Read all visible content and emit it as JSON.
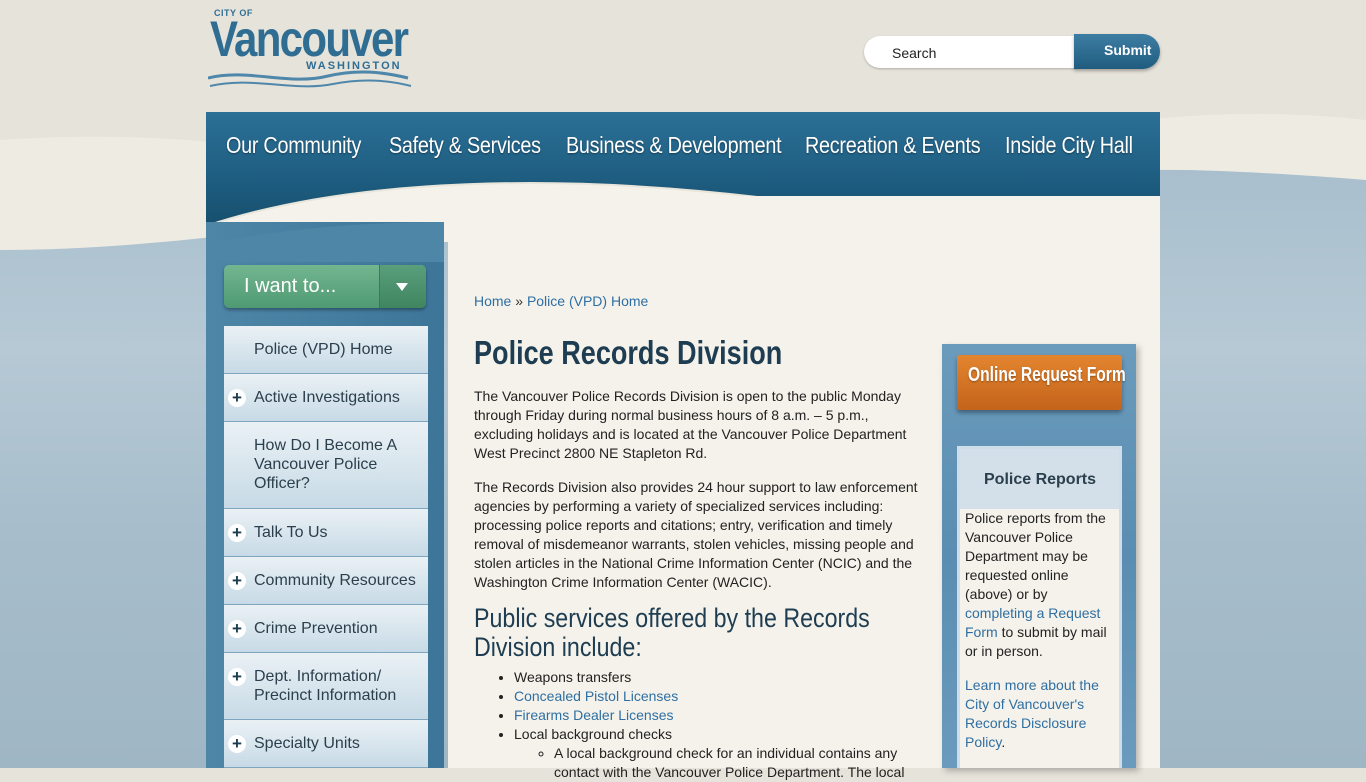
{
  "logo": {
    "city_of": "CITY OF",
    "name": "Vancouver",
    "state": "WASHINGTON"
  },
  "search": {
    "placeholder": "Search",
    "submit_label": "Submit"
  },
  "nav": [
    "Our Community",
    "Safety & Services",
    "Business & Development",
    "Recreation & Events",
    "Inside City Hall"
  ],
  "i_want_to": "I want to...",
  "sidebar": {
    "items": [
      {
        "label": "Police (VPD) Home",
        "expandable": false
      },
      {
        "label": "Active Investigations",
        "expandable": true
      },
      {
        "label": "How Do I Become A Vancouver Police Officer?",
        "expandable": false
      },
      {
        "label": "Talk To Us",
        "expandable": true
      },
      {
        "label": "Community Resources",
        "expandable": true
      },
      {
        "label": "Crime Prevention",
        "expandable": true
      },
      {
        "label": "Dept. Information/ Precinct Information",
        "expandable": true
      },
      {
        "label": "Specialty Units",
        "expandable": true
      }
    ],
    "expand_glyph": "+"
  },
  "breadcrumb": {
    "home": "Home",
    "separator": "»",
    "current": "Police (VPD) Home"
  },
  "main": {
    "title": "Police Records Division",
    "para1": "The Vancouver Police Records Division is open to the public Monday through Friday during normal business hours of 8 a.m. – 5 p.m., excluding holidays and is located at the Vancouver Police Department West Precinct 2800 NE Stapleton Rd.",
    "para2": "The Records Division also provides 24 hour support to law enforcement agencies by performing a variety of specialized services including: processing police reports and citations; entry, verification and timely removal of misdemeanor warrants, stolen vehicles, missing people and stolen articles in the National Crime Information Center (NCIC) and the Washington Crime Information Center (WACIC).",
    "services_heading": "Public services offered by the Records Division include:",
    "services": {
      "weapons": "Weapons transfers",
      "cpl": "Concealed Pistol Licenses",
      "dealer": "Firearms Dealer Licenses",
      "background": "Local background checks",
      "background_sub": "A local background check for an individual contains any contact with the Vancouver Police Department. The local"
    }
  },
  "side": {
    "online_request": "Online Request Form",
    "reports_title": "Police Reports",
    "reports_text_1": "Police reports from the Vancouver Police Department may be requested online (above) or by",
    "reports_link": "completing a Request Form",
    "reports_text_2": "to submit by mail or in person.",
    "records_policy_link": "Learn more about the City of Vancouver's Records Disclosure Policy",
    "records_policy_end": "."
  },
  "colors": {
    "nav_blue": "#1f5f83",
    "link_blue": "#2f6fa3",
    "heading_navy": "#1e3d52",
    "green_button": "#5fa882",
    "orange_button": "#d8762a",
    "content_bg": "#f4f2ea"
  }
}
